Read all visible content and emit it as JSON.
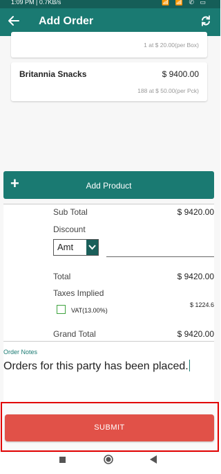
{
  "status_bar": {
    "time": "1:09 PM | 0.7KB/s",
    "icons": "📶 📶 ✆ ▭"
  },
  "app_bar": {
    "title": "Add Order",
    "back_icon": "arrow-left-icon",
    "refresh_icon": "sync-icon"
  },
  "products": [
    {
      "name": "",
      "amount": "",
      "qty_detail": "1 at $ 20.00(per Box)"
    },
    {
      "name": "Britannia Snacks",
      "amount": "$ 9400.00",
      "qty_detail": "188 at $ 50.00(per Pck)"
    }
  ],
  "add_product": {
    "label": "Add Product",
    "icon": "plus-icon"
  },
  "summary": {
    "sub_total_label": "Sub Total",
    "sub_total_value": "$ 9420.00",
    "discount_label": "Discount",
    "discount_type": "Amt",
    "discount_value": "",
    "total_label": "Total",
    "total_value": "$ 9420.00",
    "taxes_label": "Taxes Implied",
    "vat_label": "VAT(13.00%)",
    "vat_value": "$ 1224.6",
    "vat_checked": false,
    "grand_total_label": "Grand Total",
    "grand_total_value": "$ 9420.00"
  },
  "notes": {
    "label": "Order Notes",
    "value": "Orders for this party has been placed."
  },
  "submit": {
    "label": "SUBMIT"
  },
  "colors": {
    "primary": "#1a7a72",
    "statusbar": "#155e58",
    "submit": "#e15148",
    "highlight": "#e10000",
    "checkbox": "#3ea33e"
  }
}
